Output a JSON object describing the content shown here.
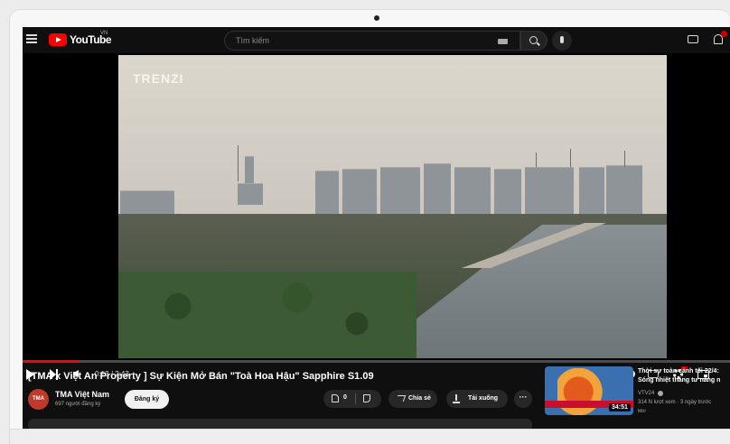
{
  "header": {
    "logo_text": "YouTube",
    "country_code": "VN",
    "search_placeholder": "Tìm kiếm"
  },
  "player": {
    "watermark": "TRENZI",
    "time_display": "0:13 / 2:43",
    "progress": 0.08,
    "icons": [
      "play-icon",
      "next-icon",
      "volume-icon",
      "autoplay-toggle",
      "subtitles-icon",
      "settings-icon",
      "miniplayer-icon"
    ]
  },
  "video": {
    "title": "[TMA x Việt An Property ] Sự Kiện Mở Bán \"Toà Hoa Hậu\" Sapphire S1.09",
    "channel": {
      "avatar_text": "TMA",
      "name": "TMA Việt Nam",
      "subscribers": "697 người đăng ký"
    },
    "subscribe_label": "Đăng ký",
    "like_count": "0",
    "share_label": "Chia sẻ",
    "download_label": "Tải xuống",
    "more_label": "···"
  },
  "recommendation": {
    "title_line1": "Thời sự toàn cảnh tối 22/4:",
    "title_line2": "Sóng nhiệt tháng tư nắng n",
    "channel": "VTV24",
    "meta": "314 N lượt xem · 3 ngày trước",
    "badge": "Mới",
    "duration": "34:51"
  },
  "colors": {
    "accent": "#ff0000",
    "background": "#0f0f0f"
  }
}
